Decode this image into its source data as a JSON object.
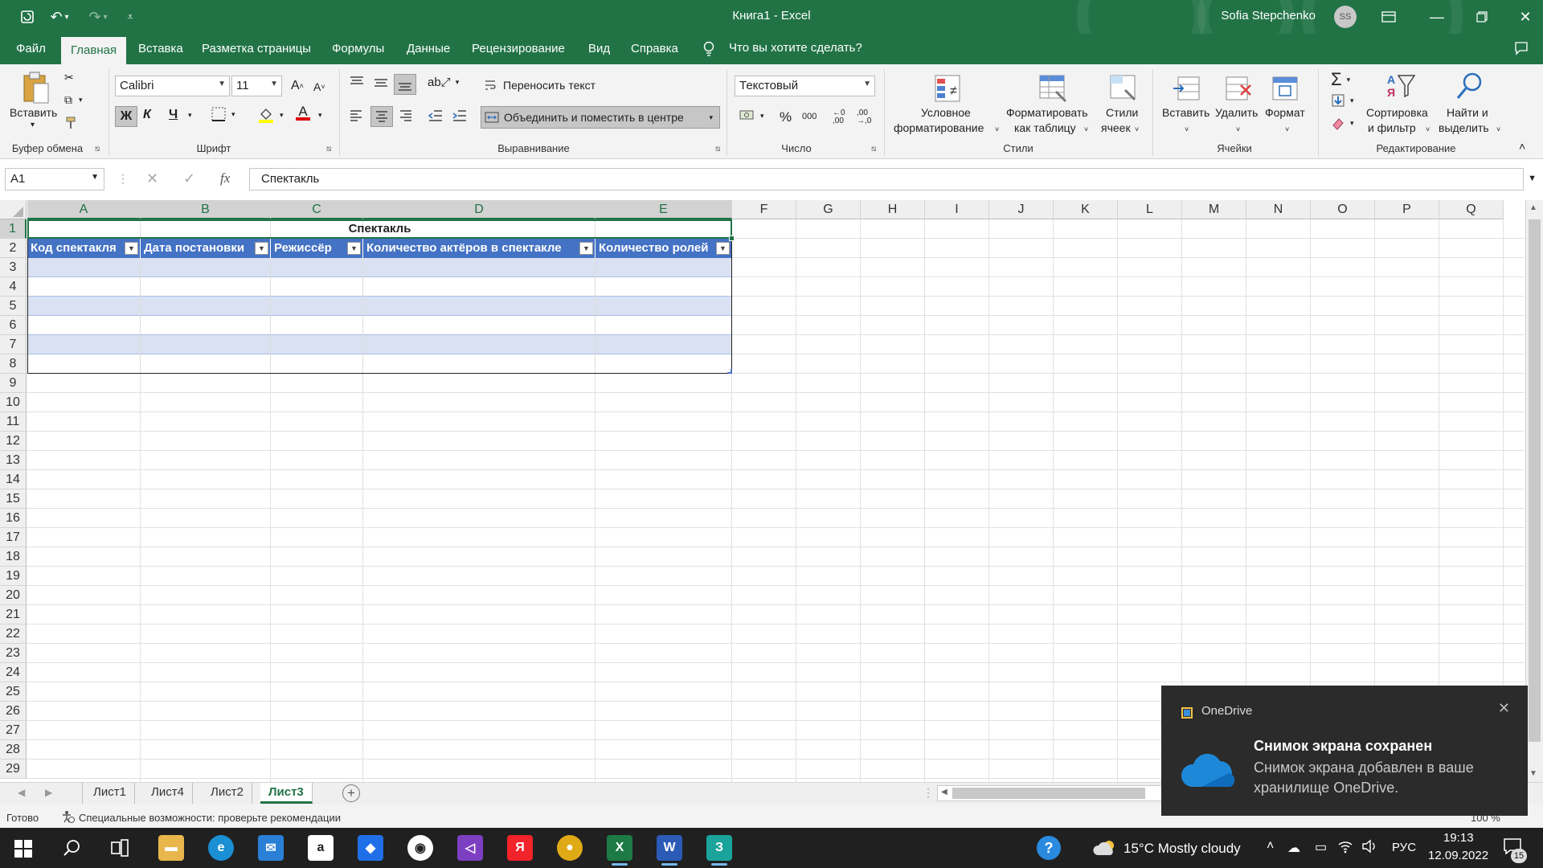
{
  "window": {
    "title": "Книга1  -  Excel",
    "user_name": "Sofia Stepchenko",
    "user_initials": "SS"
  },
  "menu": {
    "tabs": [
      "Файл",
      "Главная",
      "Вставка",
      "Разметка страницы",
      "Формулы",
      "Данные",
      "Рецензирование",
      "Вид",
      "Справка"
    ],
    "active_tab": "Главная",
    "tell_me": "Что вы хотите сделать?"
  },
  "ribbon": {
    "clipboard": {
      "paste": "Вставить",
      "group": "Буфер обмена"
    },
    "font": {
      "name": "Calibri",
      "size": "11",
      "bold": "Ж",
      "italic": "К",
      "underline": "Ч",
      "group": "Шрифт"
    },
    "alignment": {
      "wrap_text": "Переносить текст",
      "merge_center": "Объединить и поместить в центре",
      "group": "Выравнивание"
    },
    "number": {
      "format": "Текстовый",
      "percent": "%",
      "thousands": "000",
      "group": "Число"
    },
    "styles": {
      "conditional_line1": "Условное",
      "conditional_line2": "форматирование",
      "format_table_line1": "Форматировать",
      "format_table_line2": "как таблицу",
      "cell_styles_line1": "Стили",
      "cell_styles_line2": "ячеек",
      "group": "Стили"
    },
    "cells": {
      "insert": "Вставить",
      "delete": "Удалить",
      "format": "Формат",
      "group": "Ячейки"
    },
    "editing": {
      "sort_line1": "Сортировка",
      "sort_line2": "и фильтр",
      "find_line1": "Найти и",
      "find_line2": "выделить",
      "group": "Редактирование"
    }
  },
  "formula_bar": {
    "name_box": "A1",
    "fx": "fx",
    "content": "Спектакль"
  },
  "grid": {
    "columns": [
      "A",
      "B",
      "C",
      "D",
      "E",
      "F",
      "G",
      "H",
      "I",
      "J",
      "K",
      "L",
      "M",
      "N",
      "O",
      "P",
      "Q"
    ],
    "rows": [
      "1",
      "2",
      "3",
      "4",
      "5",
      "6",
      "7",
      "8",
      "9",
      "10",
      "11",
      "12",
      "13",
      "14",
      "15",
      "16",
      "17",
      "18",
      "19",
      "20",
      "21",
      "22",
      "23",
      "24",
      "25",
      "26",
      "27",
      "28",
      "29"
    ],
    "merged_title": "Спектакль",
    "table_headers": [
      "Код спектакля",
      "Дата постановки",
      "Режиссёр",
      "Количество актёров в спектакле",
      "Количество ролей"
    ],
    "table_data_rows": 6
  },
  "sheets": {
    "tabs": [
      "Лист1",
      "Лист4",
      "Лист2",
      "Лист3"
    ],
    "active": "Лист3"
  },
  "status": {
    "ready": "Готово",
    "accessibility": "Специальные возможности: проверьте рекомендации",
    "zoom": "100 %"
  },
  "toast": {
    "app": "OneDrive",
    "heading": "Снимок экрана сохранен",
    "body": "Снимок экрана добавлен в ваше хранилище OneDrive."
  },
  "taskbar": {
    "weather": "15°C  Mostly cloudy",
    "lang": "РУС",
    "time": "19:13",
    "date": "12.09.2022",
    "notifications": "15"
  },
  "colors": {
    "excel_green": "#217346",
    "table_header": "#4472c4",
    "table_band": "#d9e1f2"
  }
}
